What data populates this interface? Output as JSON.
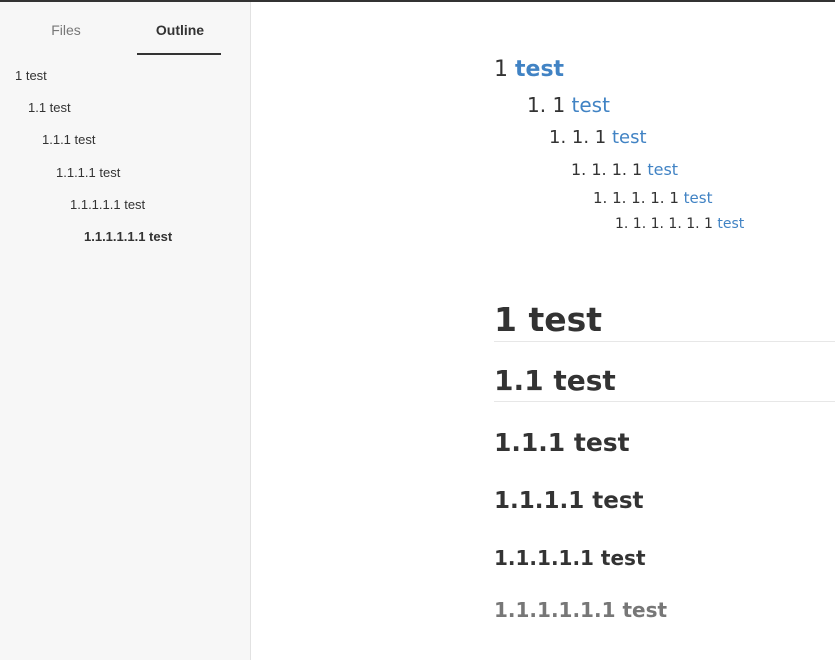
{
  "sidebar": {
    "tabs": [
      {
        "label": "Files"
      },
      {
        "label": "Outline"
      }
    ],
    "outline": [
      {
        "label": "1 test"
      },
      {
        "label": "1.1 test"
      },
      {
        "label": "1.1.1 test"
      },
      {
        "label": "1.1.1.1 test"
      },
      {
        "label": "1.1.1.1.1 test"
      },
      {
        "label": "1.1.1.1.1.1 test"
      }
    ]
  },
  "toc": [
    {
      "number": "1",
      "link": "test"
    },
    {
      "number": "1. 1",
      "link": "test"
    },
    {
      "number": "1. 1. 1",
      "link": "test"
    },
    {
      "number": "1. 1. 1. 1",
      "link": "test"
    },
    {
      "number": "1. 1. 1. 1. 1",
      "link": "test"
    },
    {
      "number": "1. 1. 1. 1. 1. 1",
      "link": "test"
    }
  ],
  "headings": [
    {
      "text": "1 test"
    },
    {
      "text": "1.1 test"
    },
    {
      "text": "1.1.1 test"
    },
    {
      "text": "1.1.1.1 test"
    },
    {
      "text": "1.1.1.1.1 test"
    },
    {
      "text": "1.1.1.1.1.1 test"
    }
  ],
  "colors": {
    "link": "#4183c4",
    "text": "#333333",
    "muted_heading": "#777777"
  }
}
